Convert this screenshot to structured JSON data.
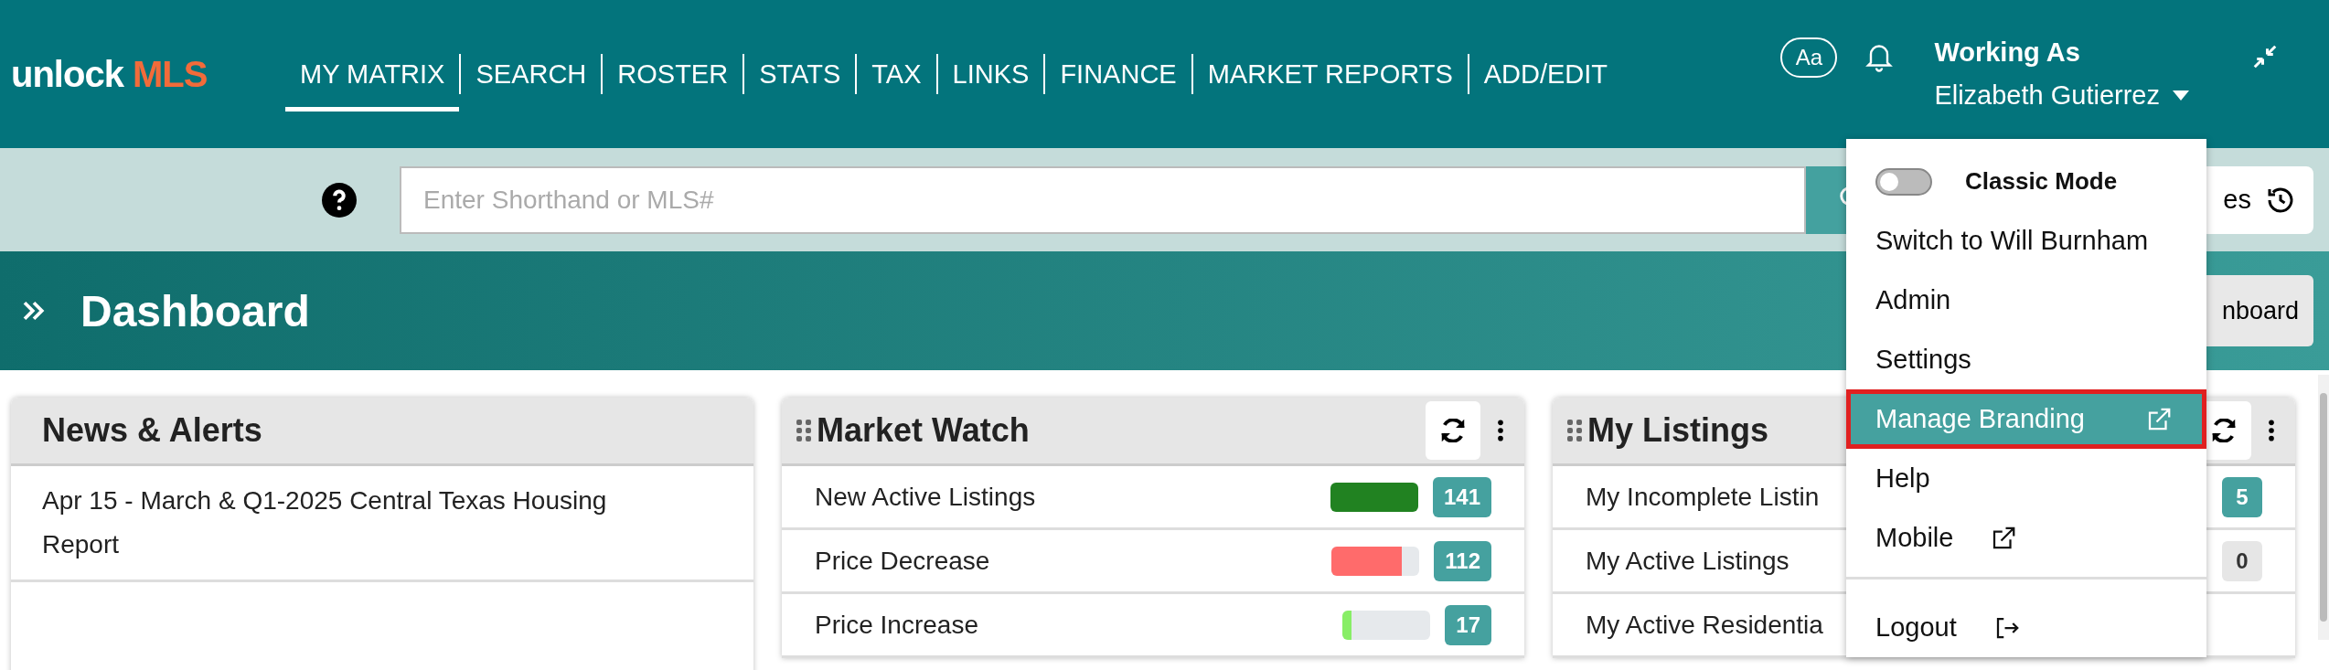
{
  "logo": {
    "text_1": "unlock",
    "text_2": "MLS"
  },
  "nav": [
    {
      "label": "MY MATRIX",
      "selected": true
    },
    {
      "label": "SEARCH",
      "selected": false
    },
    {
      "label": "ROSTER",
      "selected": false
    },
    {
      "label": "STATS",
      "selected": false
    },
    {
      "label": "TAX",
      "selected": false
    },
    {
      "label": "LINKS",
      "selected": false
    },
    {
      "label": "FINANCE",
      "selected": false
    },
    {
      "label": "MARKET REPORTS",
      "selected": false
    },
    {
      "label": "ADD/EDIT",
      "selected": false
    }
  ],
  "user": {
    "font_button": "Aa",
    "working_as": "Working As",
    "name": "Elizabeth Gutierrez"
  },
  "search": {
    "placeholder": "Enter Shorthand or MLS#",
    "history_button": "es"
  },
  "page": {
    "title": "Dashboard",
    "button": "nboard"
  },
  "dropdown": [
    {
      "kind": "toggle",
      "label": "Classic Mode",
      "on": false
    },
    {
      "kind": "link",
      "label": "Switch to Will Burnham",
      "highlighted": false
    },
    {
      "kind": "link",
      "label": "Admin",
      "highlighted": false
    },
    {
      "kind": "link",
      "label": "Settings",
      "highlighted": false
    },
    {
      "kind": "external",
      "label": "Manage Branding",
      "highlighted": true
    },
    {
      "kind": "link",
      "label": "Help",
      "highlighted": false
    },
    {
      "kind": "external",
      "label": "Mobile",
      "highlighted": false
    },
    {
      "kind": "logout",
      "label": "Logout",
      "highlighted": false
    }
  ],
  "widgets": [
    {
      "kind": "news",
      "title": "News & Alerts",
      "rows": [
        {
          "text": "Apr 15 - March & Q1-2025 Central Texas Housing Report"
        }
      ]
    },
    {
      "kind": "stats",
      "title": "Market Watch",
      "rows": [
        {
          "label": "New Active Listings",
          "level": 1,
          "color": "#218221",
          "count": "141",
          "highlighted": true
        },
        {
          "label": "Price Decrease",
          "level": 0.8,
          "color": "#ff6b6b",
          "count": "112",
          "highlighted": true
        },
        {
          "label": "Price Increase",
          "level": 0.1,
          "color": "#88ee66",
          "count": "17",
          "highlighted": true
        }
      ]
    },
    {
      "kind": "stats",
      "title": "My Listings",
      "rows": [
        {
          "label": "My Incomplete Listin",
          "count": "5",
          "highlighted": true
        },
        {
          "label": "My Active Listings",
          "count": "0",
          "highlighted": false
        },
        {
          "label": "My Active Residentia"
        }
      ]
    }
  ]
}
